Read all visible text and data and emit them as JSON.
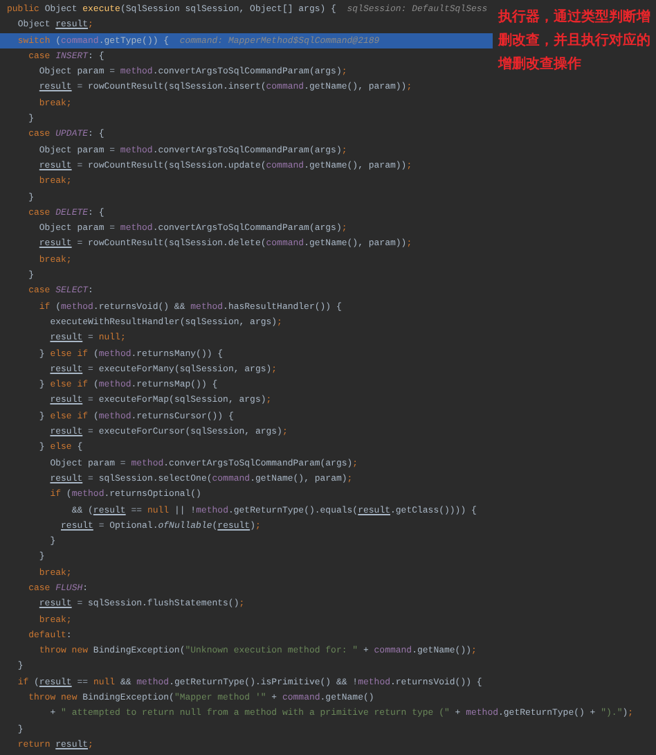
{
  "annotation": "执行器，通过类型判断增删改查，并且执行对应的增删改查操作",
  "lines": [
    {
      "selected": false,
      "tokens": [
        {
          "text": "public ",
          "kind": "keyword"
        },
        {
          "text": "Object ",
          "kind": "plain"
        },
        {
          "text": "execute",
          "kind": "declaration"
        },
        {
          "text": "(SqlSession sqlSession, Object[] args) {  ",
          "kind": "plain"
        },
        {
          "text": "sqlSession: DefaultSqlSess",
          "kind": "hint"
        }
      ]
    },
    {
      "selected": false,
      "tokens": [
        {
          "text": "  Object ",
          "kind": "plain"
        },
        {
          "text": "result",
          "kind": "local"
        },
        {
          "text": ";",
          "kind": "keyword"
        }
      ]
    },
    {
      "selected": true,
      "tokens": [
        {
          "text": "  switch ",
          "kind": "keyword"
        },
        {
          "text": "(",
          "kind": "plain"
        },
        {
          "text": "command",
          "kind": "field"
        },
        {
          "text": ".getType()) {  ",
          "kind": "plain"
        },
        {
          "text": "command: MapperMethod$SqlCommand@2189",
          "kind": "hint"
        }
      ]
    },
    {
      "selected": false,
      "tokens": [
        {
          "text": "    case ",
          "kind": "keyword"
        },
        {
          "text": "INSERT",
          "kind": "constant"
        },
        {
          "text": ": {",
          "kind": "plain"
        }
      ]
    },
    {
      "selected": false,
      "tokens": [
        {
          "text": "      Object param = ",
          "kind": "plain"
        },
        {
          "text": "method",
          "kind": "field"
        },
        {
          "text": ".convertArgsToSqlCommandParam(args)",
          "kind": "plain"
        },
        {
          "text": ";",
          "kind": "keyword"
        }
      ]
    },
    {
      "selected": false,
      "tokens": [
        {
          "text": "      result",
          "kind": "local"
        },
        {
          "text": " = rowCountResult(sqlSession.insert(",
          "kind": "plain"
        },
        {
          "text": "command",
          "kind": "field"
        },
        {
          "text": ".getName(), param))",
          "kind": "plain"
        },
        {
          "text": ";",
          "kind": "keyword"
        }
      ]
    },
    {
      "selected": false,
      "tokens": [
        {
          "text": "      break;",
          "kind": "keyword"
        }
      ]
    },
    {
      "selected": false,
      "tokens": [
        {
          "text": "    }",
          "kind": "plain"
        }
      ]
    },
    {
      "selected": false,
      "tokens": [
        {
          "text": "    case ",
          "kind": "keyword"
        },
        {
          "text": "UPDATE",
          "kind": "constant"
        },
        {
          "text": ": {",
          "kind": "plain"
        }
      ]
    },
    {
      "selected": false,
      "tokens": [
        {
          "text": "      Object param = ",
          "kind": "plain"
        },
        {
          "text": "method",
          "kind": "field"
        },
        {
          "text": ".convertArgsToSqlCommandParam(args)",
          "kind": "plain"
        },
        {
          "text": ";",
          "kind": "keyword"
        }
      ]
    },
    {
      "selected": false,
      "tokens": [
        {
          "text": "      result",
          "kind": "local"
        },
        {
          "text": " = rowCountResult(sqlSession.update(",
          "kind": "plain"
        },
        {
          "text": "command",
          "kind": "field"
        },
        {
          "text": ".getName(), param))",
          "kind": "plain"
        },
        {
          "text": ";",
          "kind": "keyword"
        }
      ]
    },
    {
      "selected": false,
      "tokens": [
        {
          "text": "      break;",
          "kind": "keyword"
        }
      ]
    },
    {
      "selected": false,
      "tokens": [
        {
          "text": "    }",
          "kind": "plain"
        }
      ]
    },
    {
      "selected": false,
      "tokens": [
        {
          "text": "    case ",
          "kind": "keyword"
        },
        {
          "text": "DELETE",
          "kind": "constant"
        },
        {
          "text": ": {",
          "kind": "plain"
        }
      ]
    },
    {
      "selected": false,
      "tokens": [
        {
          "text": "      Object param = ",
          "kind": "plain"
        },
        {
          "text": "method",
          "kind": "field"
        },
        {
          "text": ".convertArgsToSqlCommandParam(args)",
          "kind": "plain"
        },
        {
          "text": ";",
          "kind": "keyword"
        }
      ]
    },
    {
      "selected": false,
      "tokens": [
        {
          "text": "      result",
          "kind": "local"
        },
        {
          "text": " = rowCountResult(sqlSession.delete(",
          "kind": "plain"
        },
        {
          "text": "command",
          "kind": "field"
        },
        {
          "text": ".getName(), param))",
          "kind": "plain"
        },
        {
          "text": ";",
          "kind": "keyword"
        }
      ]
    },
    {
      "selected": false,
      "tokens": [
        {
          "text": "      break;",
          "kind": "keyword"
        }
      ]
    },
    {
      "selected": false,
      "tokens": [
        {
          "text": "    }",
          "kind": "plain"
        }
      ]
    },
    {
      "selected": false,
      "tokens": [
        {
          "text": "    case ",
          "kind": "keyword"
        },
        {
          "text": "SELECT",
          "kind": "constant"
        },
        {
          "text": ":",
          "kind": "plain"
        }
      ]
    },
    {
      "selected": false,
      "tokens": [
        {
          "text": "      if ",
          "kind": "keyword"
        },
        {
          "text": "(",
          "kind": "plain"
        },
        {
          "text": "method",
          "kind": "field"
        },
        {
          "text": ".returnsVoid() && ",
          "kind": "plain"
        },
        {
          "text": "method",
          "kind": "field"
        },
        {
          "text": ".hasResultHandler()) {",
          "kind": "plain"
        }
      ]
    },
    {
      "selected": false,
      "tokens": [
        {
          "text": "        executeWithResultHandler(sqlSession, args)",
          "kind": "plain"
        },
        {
          "text": ";",
          "kind": "keyword"
        }
      ]
    },
    {
      "selected": false,
      "tokens": [
        {
          "text": "        result",
          "kind": "local"
        },
        {
          "text": " = ",
          "kind": "plain"
        },
        {
          "text": "null;",
          "kind": "keyword"
        }
      ]
    },
    {
      "selected": false,
      "tokens": [
        {
          "text": "      } ",
          "kind": "plain"
        },
        {
          "text": "else if ",
          "kind": "keyword"
        },
        {
          "text": "(",
          "kind": "plain"
        },
        {
          "text": "method",
          "kind": "field"
        },
        {
          "text": ".returnsMany()) {",
          "kind": "plain"
        }
      ]
    },
    {
      "selected": false,
      "tokens": [
        {
          "text": "        result",
          "kind": "local"
        },
        {
          "text": " = executeForMany(sqlSession, args)",
          "kind": "plain"
        },
        {
          "text": ";",
          "kind": "keyword"
        }
      ]
    },
    {
      "selected": false,
      "tokens": [
        {
          "text": "      } ",
          "kind": "plain"
        },
        {
          "text": "else if ",
          "kind": "keyword"
        },
        {
          "text": "(",
          "kind": "plain"
        },
        {
          "text": "method",
          "kind": "field"
        },
        {
          "text": ".returnsMap()) {",
          "kind": "plain"
        }
      ]
    },
    {
      "selected": false,
      "tokens": [
        {
          "text": "        result",
          "kind": "local"
        },
        {
          "text": " = executeForMap(sqlSession, args)",
          "kind": "plain"
        },
        {
          "text": ";",
          "kind": "keyword"
        }
      ]
    },
    {
      "selected": false,
      "tokens": [
        {
          "text": "      } ",
          "kind": "plain"
        },
        {
          "text": "else if ",
          "kind": "keyword"
        },
        {
          "text": "(",
          "kind": "plain"
        },
        {
          "text": "method",
          "kind": "field"
        },
        {
          "text": ".returnsCursor()) {",
          "kind": "plain"
        }
      ]
    },
    {
      "selected": false,
      "tokens": [
        {
          "text": "        result",
          "kind": "local"
        },
        {
          "text": " = executeForCursor(sqlSession, args)",
          "kind": "plain"
        },
        {
          "text": ";",
          "kind": "keyword"
        }
      ]
    },
    {
      "selected": false,
      "tokens": [
        {
          "text": "      } ",
          "kind": "plain"
        },
        {
          "text": "else ",
          "kind": "keyword"
        },
        {
          "text": "{",
          "kind": "plain"
        }
      ]
    },
    {
      "selected": false,
      "tokens": [
        {
          "text": "        Object param = ",
          "kind": "plain"
        },
        {
          "text": "method",
          "kind": "field"
        },
        {
          "text": ".convertArgsToSqlCommandParam(args)",
          "kind": "plain"
        },
        {
          "text": ";",
          "kind": "keyword"
        }
      ]
    },
    {
      "selected": false,
      "tokens": [
        {
          "text": "        result",
          "kind": "local"
        },
        {
          "text": " = sqlSession.selectOne(",
          "kind": "plain"
        },
        {
          "text": "command",
          "kind": "field"
        },
        {
          "text": ".getName(), param)",
          "kind": "plain"
        },
        {
          "text": ";",
          "kind": "keyword"
        }
      ]
    },
    {
      "selected": false,
      "tokens": [
        {
          "text": "        if ",
          "kind": "keyword"
        },
        {
          "text": "(",
          "kind": "plain"
        },
        {
          "text": "method",
          "kind": "field"
        },
        {
          "text": ".returnsOptional()",
          "kind": "plain"
        }
      ]
    },
    {
      "selected": false,
      "tokens": [
        {
          "text": "            && (",
          "kind": "plain"
        },
        {
          "text": "result",
          "kind": "local"
        },
        {
          "text": " == ",
          "kind": "plain"
        },
        {
          "text": "null ",
          "kind": "keyword"
        },
        {
          "text": "|| !",
          "kind": "plain"
        },
        {
          "text": "method",
          "kind": "field"
        },
        {
          "text": ".getReturnType().equals(",
          "kind": "plain"
        },
        {
          "text": "result",
          "kind": "local"
        },
        {
          "text": ".getClass()))) {",
          "kind": "plain"
        }
      ]
    },
    {
      "selected": false,
      "tokens": [
        {
          "text": "          result",
          "kind": "local"
        },
        {
          "text": " = Optional.",
          "kind": "plain"
        },
        {
          "text": "ofNullable",
          "kind": "static"
        },
        {
          "text": "(",
          "kind": "plain"
        },
        {
          "text": "result",
          "kind": "local"
        },
        {
          "text": ")",
          "kind": "plain"
        },
        {
          "text": ";",
          "kind": "keyword"
        }
      ]
    },
    {
      "selected": false,
      "tokens": [
        {
          "text": "        }",
          "kind": "plain"
        }
      ]
    },
    {
      "selected": false,
      "tokens": [
        {
          "text": "      }",
          "kind": "plain"
        }
      ]
    },
    {
      "selected": false,
      "tokens": [
        {
          "text": "      break;",
          "kind": "keyword"
        }
      ]
    },
    {
      "selected": false,
      "tokens": [
        {
          "text": "    case ",
          "kind": "keyword"
        },
        {
          "text": "FLUSH",
          "kind": "constant"
        },
        {
          "text": ":",
          "kind": "plain"
        }
      ]
    },
    {
      "selected": false,
      "tokens": [
        {
          "text": "      result",
          "kind": "local"
        },
        {
          "text": " = sqlSession.flushStatements()",
          "kind": "plain"
        },
        {
          "text": ";",
          "kind": "keyword"
        }
      ]
    },
    {
      "selected": false,
      "tokens": [
        {
          "text": "      break;",
          "kind": "keyword"
        }
      ]
    },
    {
      "selected": false,
      "tokens": [
        {
          "text": "    default",
          "kind": "keyword"
        },
        {
          "text": ":",
          "kind": "plain"
        }
      ]
    },
    {
      "selected": false,
      "tokens": [
        {
          "text": "      throw new ",
          "kind": "keyword"
        },
        {
          "text": "BindingException(",
          "kind": "plain"
        },
        {
          "text": "\"Unknown execution method for: \" ",
          "kind": "string"
        },
        {
          "text": "+ ",
          "kind": "plain"
        },
        {
          "text": "command",
          "kind": "field"
        },
        {
          "text": ".getName())",
          "kind": "plain"
        },
        {
          "text": ";",
          "kind": "keyword"
        }
      ]
    },
    {
      "selected": false,
      "tokens": [
        {
          "text": "  }",
          "kind": "plain"
        }
      ]
    },
    {
      "selected": false,
      "tokens": [
        {
          "text": "  if ",
          "kind": "keyword"
        },
        {
          "text": "(",
          "kind": "plain"
        },
        {
          "text": "result",
          "kind": "local"
        },
        {
          "text": " == ",
          "kind": "plain"
        },
        {
          "text": "null ",
          "kind": "keyword"
        },
        {
          "text": "&& ",
          "kind": "plain"
        },
        {
          "text": "method",
          "kind": "field"
        },
        {
          "text": ".getReturnType().isPrimitive() && !",
          "kind": "plain"
        },
        {
          "text": "method",
          "kind": "field"
        },
        {
          "text": ".returnsVoid()) {",
          "kind": "plain"
        }
      ]
    },
    {
      "selected": false,
      "tokens": [
        {
          "text": "    throw new ",
          "kind": "keyword"
        },
        {
          "text": "BindingException(",
          "kind": "plain"
        },
        {
          "text": "\"Mapper method '\" ",
          "kind": "string"
        },
        {
          "text": "+ ",
          "kind": "plain"
        },
        {
          "text": "command",
          "kind": "field"
        },
        {
          "text": ".getName()",
          "kind": "plain"
        }
      ]
    },
    {
      "selected": false,
      "tokens": [
        {
          "text": "        + ",
          "kind": "plain"
        },
        {
          "text": "\" attempted to return null from a method with a primitive return type (\" ",
          "kind": "string"
        },
        {
          "text": "+ ",
          "kind": "plain"
        },
        {
          "text": "method",
          "kind": "field"
        },
        {
          "text": ".getReturnType() + ",
          "kind": "plain"
        },
        {
          "text": "\").\"",
          "kind": "string"
        },
        {
          "text": ")",
          "kind": "plain"
        },
        {
          "text": ";",
          "kind": "keyword"
        }
      ]
    },
    {
      "selected": false,
      "tokens": [
        {
          "text": "  }",
          "kind": "plain"
        }
      ]
    },
    {
      "selected": false,
      "tokens": [
        {
          "text": "  return ",
          "kind": "keyword"
        },
        {
          "text": "result",
          "kind": "local"
        },
        {
          "text": ";",
          "kind": "keyword"
        }
      ]
    }
  ]
}
